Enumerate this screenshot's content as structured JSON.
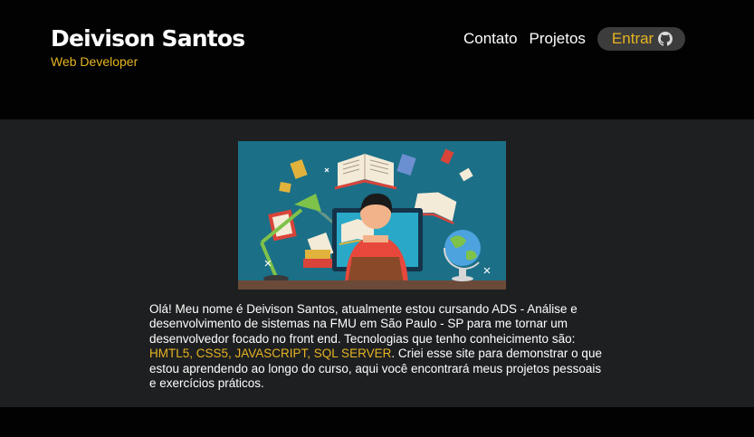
{
  "header": {
    "name": "Deivison Santos",
    "subtitle": "Web Developer"
  },
  "nav": {
    "contact": "Contato",
    "projects": "Projetos",
    "login": "Entrar",
    "login_icon": "github-icon"
  },
  "main": {
    "illustration": "student-studying-at-computer-illustration",
    "text_intro": "Olá! Meu nome é Deivison Santos, atualmente estou cursando ADS - Análise e desenvolvimento de sistemas na FMU em São Paulo - SP para me tornar um desenvolvedor focado no front end. Tecnologias que tenho conheicimento são: ",
    "technologies": "HMTL5, CSS5, JAVASCRIPT, SQL SERVER",
    "text_outro": ". Criei esse site para demonstrar o que estou aprendendo ao longo do curso, aqui você encontrará meus projetos pessoais e exercícios práticos."
  },
  "colors": {
    "accent": "#e6b422",
    "background": "#020202",
    "panel": "#1e1f21",
    "illustration_bg": "#1b6f87"
  }
}
